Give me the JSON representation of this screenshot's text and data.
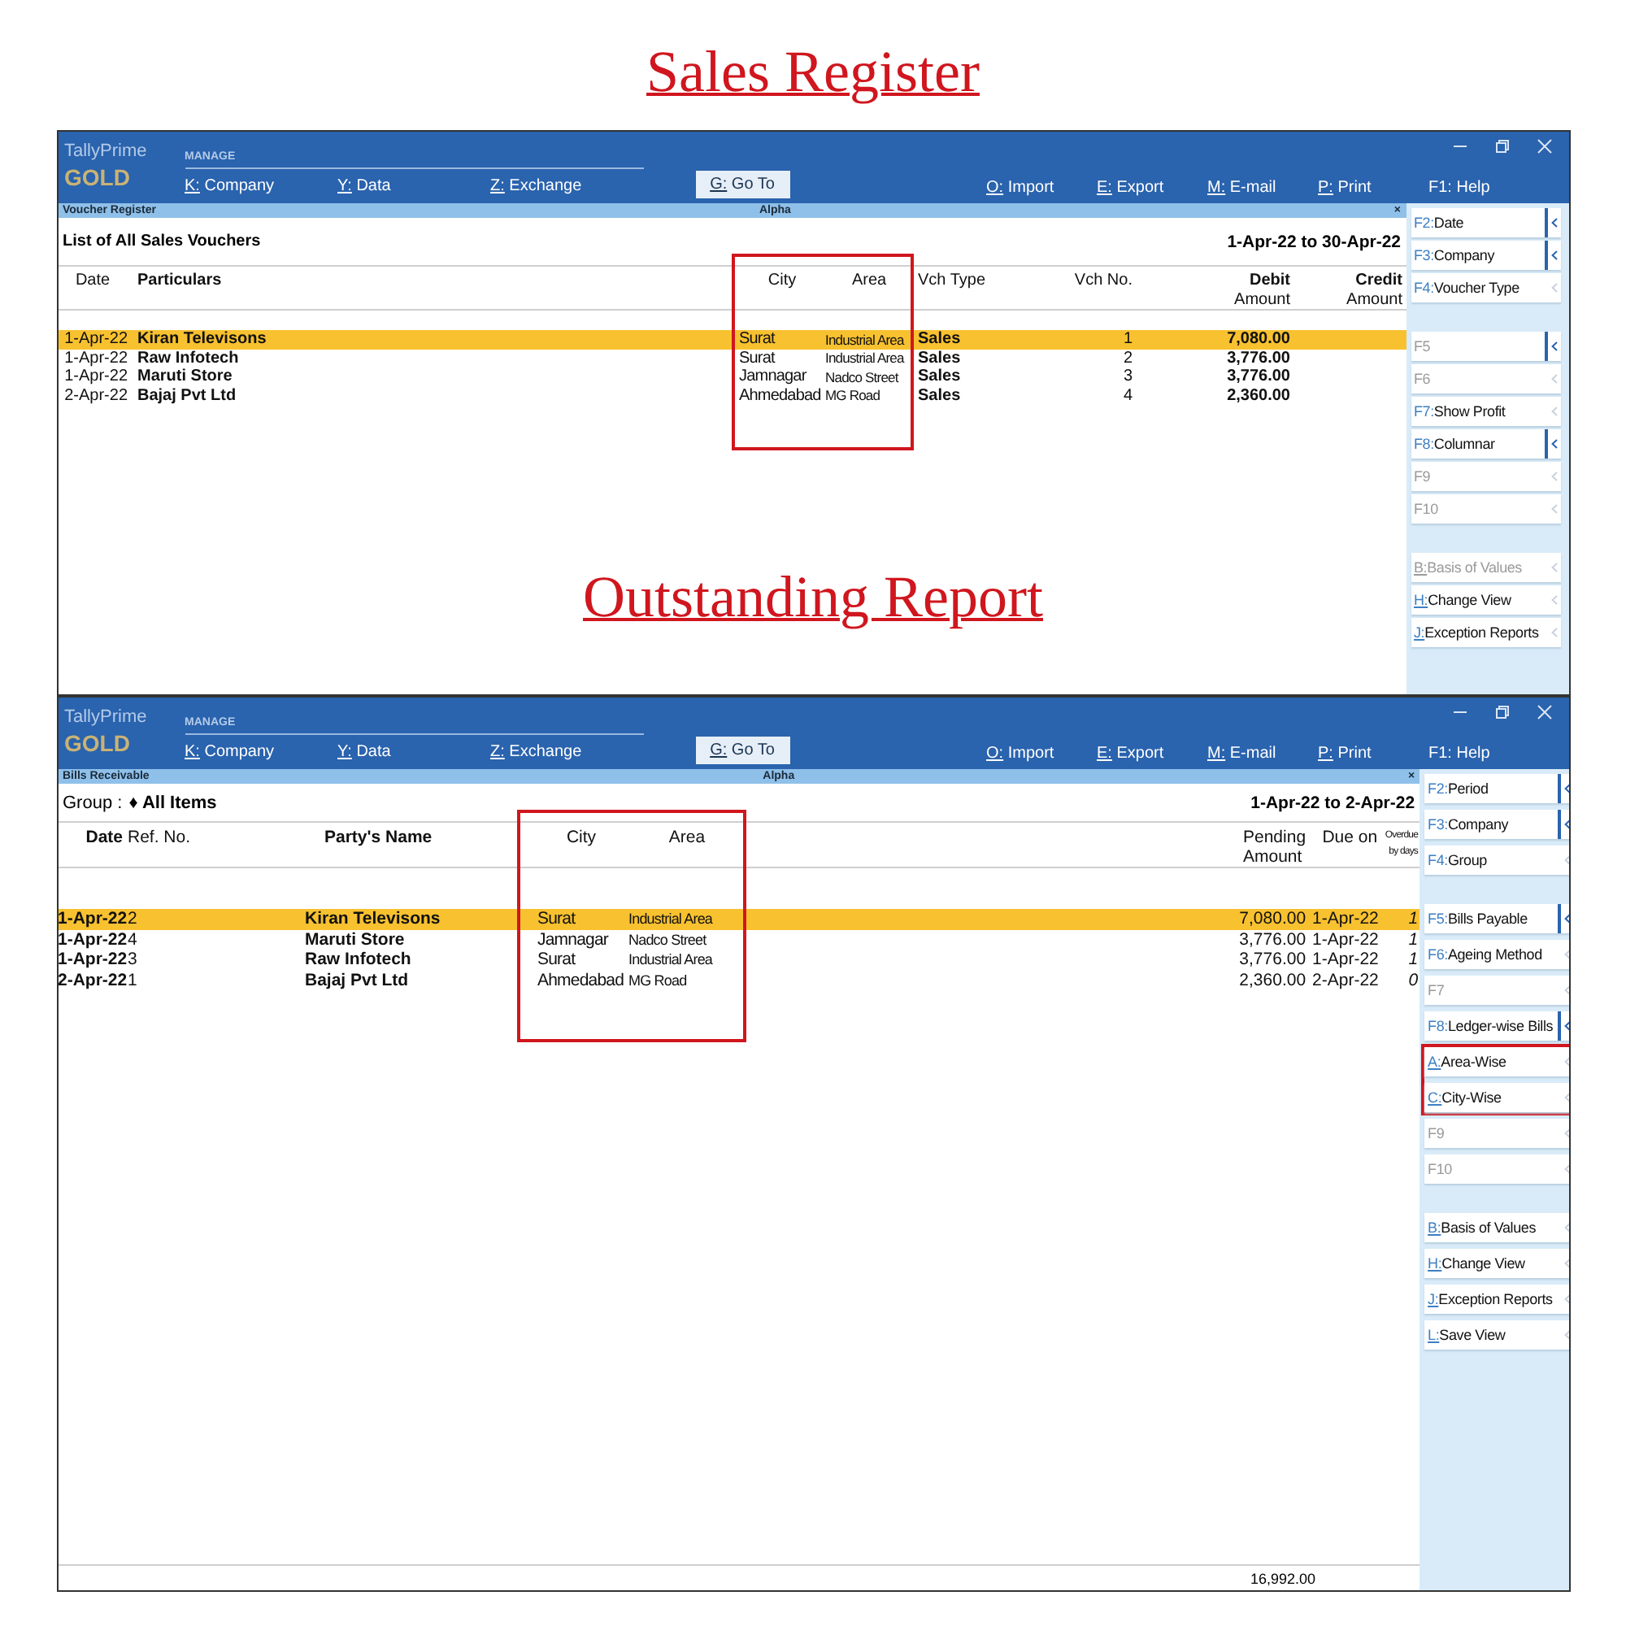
{
  "captions": [
    "Sales Register",
    "Outstanding Report"
  ],
  "windows": [
    {
      "kind": "voucher_register",
      "brand": "TallyPrime",
      "edition": "GOLD",
      "section": "MANAGE",
      "menu": [
        {
          "key": "K:",
          "label": "Company"
        },
        {
          "key": "Y:",
          "label": "Data"
        },
        {
          "key": "Z:",
          "label": "Exchange"
        }
      ],
      "goto": {
        "key": "G:",
        "label": "Go To"
      },
      "actions": [
        {
          "key": "O:",
          "label": "Import"
        },
        {
          "key": "E:",
          "label": "Export"
        },
        {
          "key": "M:",
          "label": "E-mail"
        },
        {
          "key": "P:",
          "label": "Print"
        }
      ],
      "help": {
        "key": "F1:",
        "label": "Help"
      },
      "report_name": "Voucher Register",
      "company": "Alpha",
      "close": "×",
      "info": {
        "label": "List of All Sales Vouchers"
      },
      "period": "1-Apr-22 to 30-Apr-22",
      "columns": [
        {
          "lines": [
            "Date"
          ]
        },
        {
          "lines": [
            "Particulars"
          ]
        },
        {
          "lines": [
            "City"
          ]
        },
        {
          "lines": [
            "Area"
          ]
        },
        {
          "lines": [
            "Vch Type"
          ]
        },
        {
          "lines": [
            "Vch No."
          ]
        },
        {
          "lines": [
            "Debit",
            "Amount"
          ]
        },
        {
          "lines": [
            "Credit",
            "Amount"
          ]
        }
      ],
      "rows": [
        {
          "selected": true,
          "cells": [
            "1-Apr-22",
            "Kiran Televisons",
            "Surat",
            "Industrial Area",
            "Sales",
            "1",
            "7,080.00"
          ]
        },
        {
          "selected": false,
          "cells": [
            "1-Apr-22",
            "Raw Infotech",
            "Surat",
            "Industrial Area",
            "Sales",
            "2",
            "3,776.00"
          ]
        },
        {
          "selected": false,
          "cells": [
            "1-Apr-22",
            "Maruti Store",
            "Jamnagar",
            "Nadco Street",
            "Sales",
            "3",
            "3,776.00"
          ]
        },
        {
          "selected": false,
          "cells": [
            "2-Apr-22",
            "Bajaj Pvt Ltd",
            "Ahmedabad",
            "MG Road",
            "Sales",
            "4",
            "2,360.00"
          ]
        }
      ],
      "panel": [
        [
          {
            "key": "F2:",
            "label": "Date",
            "disabled": false,
            "submenu": true,
            "underline": false,
            "highlighted": false
          },
          {
            "key": "F3:",
            "label": "Company",
            "disabled": false,
            "submenu": true,
            "underline": false,
            "highlighted": false
          },
          {
            "key": "F4:",
            "label": "Voucher Type",
            "disabled": false,
            "submenu": false,
            "underline": false,
            "highlighted": false
          }
        ],
        [
          {
            "key": "F5",
            "disabled": true,
            "submenu": true,
            "underline": false,
            "highlighted": false
          },
          {
            "key": "F6",
            "disabled": true,
            "submenu": false,
            "underline": false,
            "highlighted": false
          },
          {
            "key": "F7:",
            "label": "Show Profit",
            "disabled": false,
            "submenu": false,
            "underline": false,
            "highlighted": false
          },
          {
            "key": "F8:",
            "label": "Columnar",
            "disabled": false,
            "submenu": true,
            "underline": false,
            "highlighted": false
          },
          {
            "key": "F9",
            "disabled": true,
            "submenu": false,
            "underline": false,
            "highlighted": false
          },
          {
            "key": "F10",
            "disabled": true,
            "submenu": false,
            "underline": false,
            "highlighted": false
          }
        ],
        [
          {
            "key": "B:",
            "label": "Basis of Values",
            "disabled": true,
            "submenu": false,
            "underline": true,
            "highlighted": false
          },
          {
            "key": "H:",
            "label": "Change View",
            "disabled": false,
            "submenu": false,
            "underline": true,
            "highlighted": false
          },
          {
            "key": "J:",
            "label": "Exception Reports",
            "disabled": false,
            "submenu": false,
            "underline": true,
            "highlighted": false
          }
        ]
      ]
    },
    {
      "kind": "bills_receivable",
      "brand": "TallyPrime",
      "edition": "GOLD",
      "section": "MANAGE",
      "menu": [
        {
          "key": "K:",
          "label": "Company"
        },
        {
          "key": "Y:",
          "label": "Data"
        },
        {
          "key": "Z:",
          "label": "Exchange"
        }
      ],
      "goto": {
        "key": "G:",
        "label": "Go To"
      },
      "actions": [
        {
          "key": "O:",
          "label": "Import"
        },
        {
          "key": "E:",
          "label": "Export"
        },
        {
          "key": "M:",
          "label": "E-mail"
        },
        {
          "key": "P:",
          "label": "Print"
        }
      ],
      "help": {
        "key": "F1:",
        "label": "Help"
      },
      "report_name": "Bills Receivable",
      "company": "Alpha",
      "close": "×",
      "info": {
        "label": "Group :",
        "value": "♦ All Items"
      },
      "period": "1-Apr-22 to 2-Apr-22",
      "columns": [
        {
          "lines": [
            "Date"
          ]
        },
        {
          "lines": [
            "Ref. No."
          ]
        },
        {
          "lines": [
            "Party's Name"
          ]
        },
        {
          "lines": [
            "City"
          ]
        },
        {
          "lines": [
            "Area"
          ]
        },
        {
          "lines": [
            "Pending",
            "Amount"
          ]
        },
        {
          "lines": [
            "Due on"
          ]
        },
        {
          "lines": [
            "Overdue",
            "by days"
          ]
        }
      ],
      "rows": [
        {
          "selected": true,
          "cells": [
            "1-Apr-22",
            "2",
            "Kiran Televisons",
            "Surat",
            "Industrial Area",
            "7,080.00",
            "1-Apr-22",
            "1"
          ]
        },
        {
          "selected": false,
          "cells": [
            "1-Apr-22",
            "4",
            "Maruti Store",
            "Jamnagar",
            "Nadco Street",
            "3,776.00",
            "1-Apr-22",
            "1"
          ]
        },
        {
          "selected": false,
          "cells": [
            "1-Apr-22",
            "3",
            "Raw Infotech",
            "Surat",
            "Industrial Area",
            "3,776.00",
            "1-Apr-22",
            "1"
          ]
        },
        {
          "selected": false,
          "cells": [
            "2-Apr-22",
            "1",
            "Bajaj Pvt Ltd",
            "Ahmedabad",
            "MG Road",
            "2,360.00",
            "2-Apr-22",
            "0"
          ]
        }
      ],
      "total": "16,992.00",
      "panel": [
        [
          {
            "key": "F2:",
            "label": "Period",
            "disabled": false,
            "submenu": true,
            "underline": false,
            "highlighted": false
          },
          {
            "key": "F3:",
            "label": "Company",
            "disabled": false,
            "submenu": true,
            "underline": false,
            "highlighted": false
          },
          {
            "key": "F4:",
            "label": "Group",
            "disabled": false,
            "submenu": false,
            "underline": false,
            "highlighted": false
          }
        ],
        [
          {
            "key": "F5:",
            "label": "Bills Payable",
            "disabled": false,
            "submenu": true,
            "underline": false,
            "highlighted": false
          },
          {
            "key": "F6:",
            "label": "Ageing Method",
            "disabled": false,
            "submenu": false,
            "underline": false,
            "highlighted": false
          },
          {
            "key": "F7",
            "disabled": true,
            "submenu": false,
            "underline": false,
            "highlighted": false
          },
          {
            "key": "F8:",
            "label": "Ledger-wise Bills",
            "disabled": false,
            "submenu": true,
            "underline": false,
            "highlighted": false
          },
          {
            "key": "A:",
            "label": "Area-Wise",
            "disabled": false,
            "submenu": false,
            "underline": true,
            "highlighted": true
          },
          {
            "key": "C:",
            "label": "City-Wise",
            "disabled": false,
            "submenu": false,
            "underline": true,
            "highlighted": true
          },
          {
            "key": "F9",
            "disabled": true,
            "submenu": false,
            "underline": false,
            "highlighted": false
          },
          {
            "key": "F10",
            "disabled": true,
            "submenu": false,
            "underline": false,
            "highlighted": false
          }
        ],
        [
          {
            "key": "B:",
            "label": "Basis of Values",
            "disabled": false,
            "submenu": false,
            "underline": true,
            "highlighted": false
          },
          {
            "key": "H:",
            "label": "Change View",
            "disabled": false,
            "submenu": false,
            "underline": true,
            "highlighted": false
          },
          {
            "key": "J:",
            "label": "Exception Reports",
            "disabled": false,
            "submenu": false,
            "underline": true,
            "highlighted": false
          },
          {
            "key": "L:",
            "label": "Save View",
            "disabled": false,
            "submenu": false,
            "underline": true,
            "highlighted": false
          }
        ]
      ]
    }
  ]
}
